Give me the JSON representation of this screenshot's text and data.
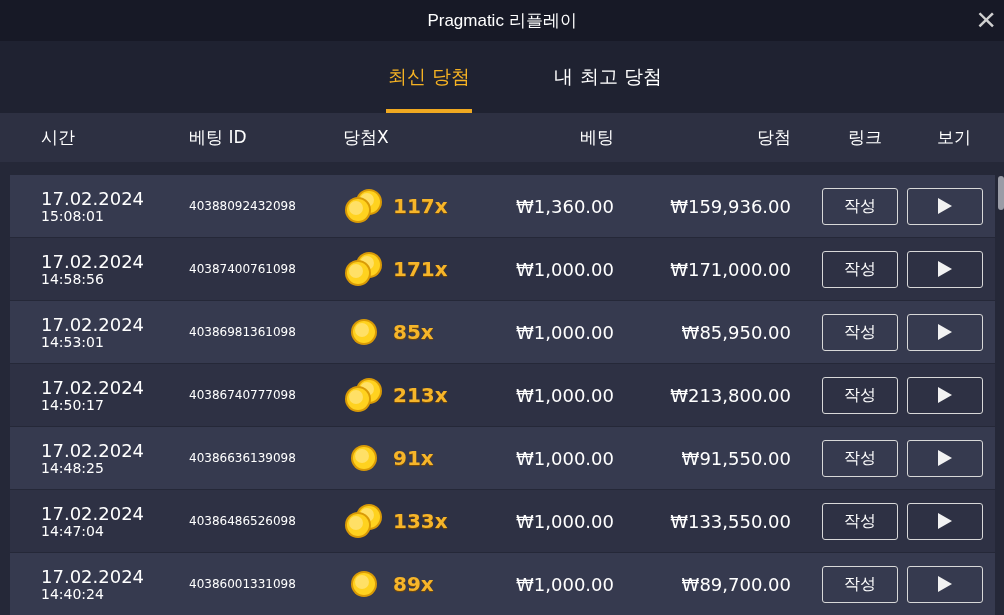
{
  "window": {
    "title": "Pragmatic 리플레이",
    "close": "×"
  },
  "tabs": [
    {
      "label": "최신 당첨",
      "selected": true
    },
    {
      "label": "내 최고 당첨",
      "selected": false
    }
  ],
  "table": {
    "columns": [
      "시간",
      "베팅 ID",
      "당첨X",
      "베팅",
      "당첨",
      "링크",
      "보기"
    ],
    "rows": [
      {
        "date": "17.02.2024",
        "time": "15:08:01",
        "bet_id": "40388092432098",
        "kind": "double",
        "multiplier": "117x",
        "bet": "₩1,360.00",
        "win": "₩159,936.00",
        "link": "작성"
      },
      {
        "date": "17.02.2024",
        "time": "14:58:56",
        "bet_id": "40387400761098",
        "kind": "double",
        "multiplier": "171x",
        "bet": "₩1,000.00",
        "win": "₩171,000.00",
        "link": "작성"
      },
      {
        "date": "17.02.2024",
        "time": "14:53:01",
        "bet_id": "40386981361098",
        "kind": "single",
        "multiplier": "85x",
        "bet": "₩1,000.00",
        "win": "₩85,950.00",
        "link": "작성"
      },
      {
        "date": "17.02.2024",
        "time": "14:50:17",
        "bet_id": "40386740777098",
        "kind": "double",
        "multiplier": "213x",
        "bet": "₩1,000.00",
        "win": "₩213,800.00",
        "link": "작성"
      },
      {
        "date": "17.02.2024",
        "time": "14:48:25",
        "bet_id": "40386636139098",
        "kind": "single",
        "multiplier": "91x",
        "bet": "₩1,000.00",
        "win": "₩91,550.00",
        "link": "작성"
      },
      {
        "date": "17.02.2024",
        "time": "14:47:04",
        "bet_id": "40386486526098",
        "kind": "double",
        "multiplier": "133x",
        "bet": "₩1,000.00",
        "win": "₩133,550.00",
        "link": "작성"
      },
      {
        "date": "17.02.2024",
        "time": "14:40:24",
        "bet_id": "40386001331098",
        "kind": "single",
        "multiplier": "89x",
        "bet": "₩1,000.00",
        "win": "₩89,700.00",
        "link": "작성"
      }
    ]
  }
}
